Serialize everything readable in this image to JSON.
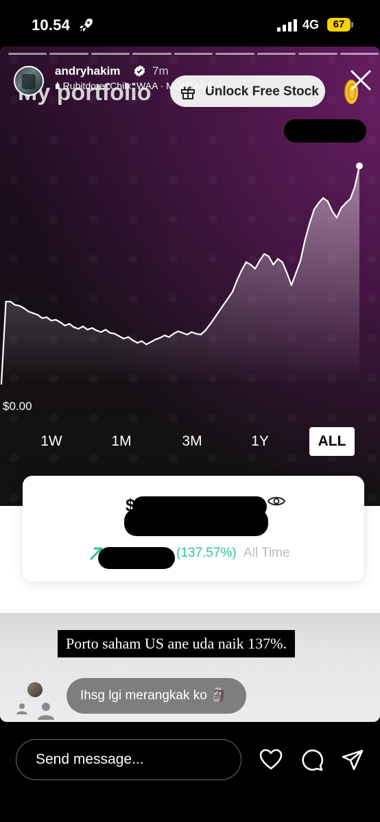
{
  "status_bar": {
    "time": "10.54",
    "network": "4G",
    "battery": "67"
  },
  "story": {
    "username": "andryhakim",
    "time_ago": "7m",
    "music": "Rubitdore, Chilx, WAA · MONTAGE",
    "progress_segments": 9
  },
  "app": {
    "title": "My portfolio",
    "unlock_label": "Unlock Free Stock",
    "zero_label": "$0.00",
    "ranges": [
      "1W",
      "1M",
      "3M",
      "1Y",
      "ALL"
    ],
    "active_range": "ALL",
    "currency_symbol": "$",
    "change_pct": "(137.57%)",
    "period_label": "All Time",
    "accent_green": "#2bc48a"
  },
  "caption": "Porto saham US ane uda naik 137%.",
  "reply": {
    "text": "Ihsg lgi merangkak ko 🗿"
  },
  "bottom_bar": {
    "message_placeholder": "Send message..."
  },
  "chart_data": {
    "type": "area",
    "series": [
      {
        "values": [
          0,
          100,
          100,
          96,
          95,
          92,
          88,
          86,
          84,
          80,
          81,
          77,
          78,
          75,
          71,
          73,
          69,
          67,
          70,
          66,
          68,
          65,
          63,
          66,
          62,
          61,
          58,
          55,
          57,
          53,
          50,
          52,
          48,
          51,
          54,
          56,
          59,
          57,
          61,
          64,
          62,
          60,
          63,
          61,
          60,
          65,
          72,
          80,
          88,
          96,
          104,
          112,
          126,
          138,
          148,
          145,
          140,
          150,
          158,
          155,
          145,
          152,
          148,
          135,
          120,
          135,
          150,
          175,
          195,
          212,
          220,
          226,
          222,
          210,
          202,
          214,
          220,
          225,
          240,
          265
        ]
      }
    ],
    "ylim": [
      0,
      270
    ]
  }
}
